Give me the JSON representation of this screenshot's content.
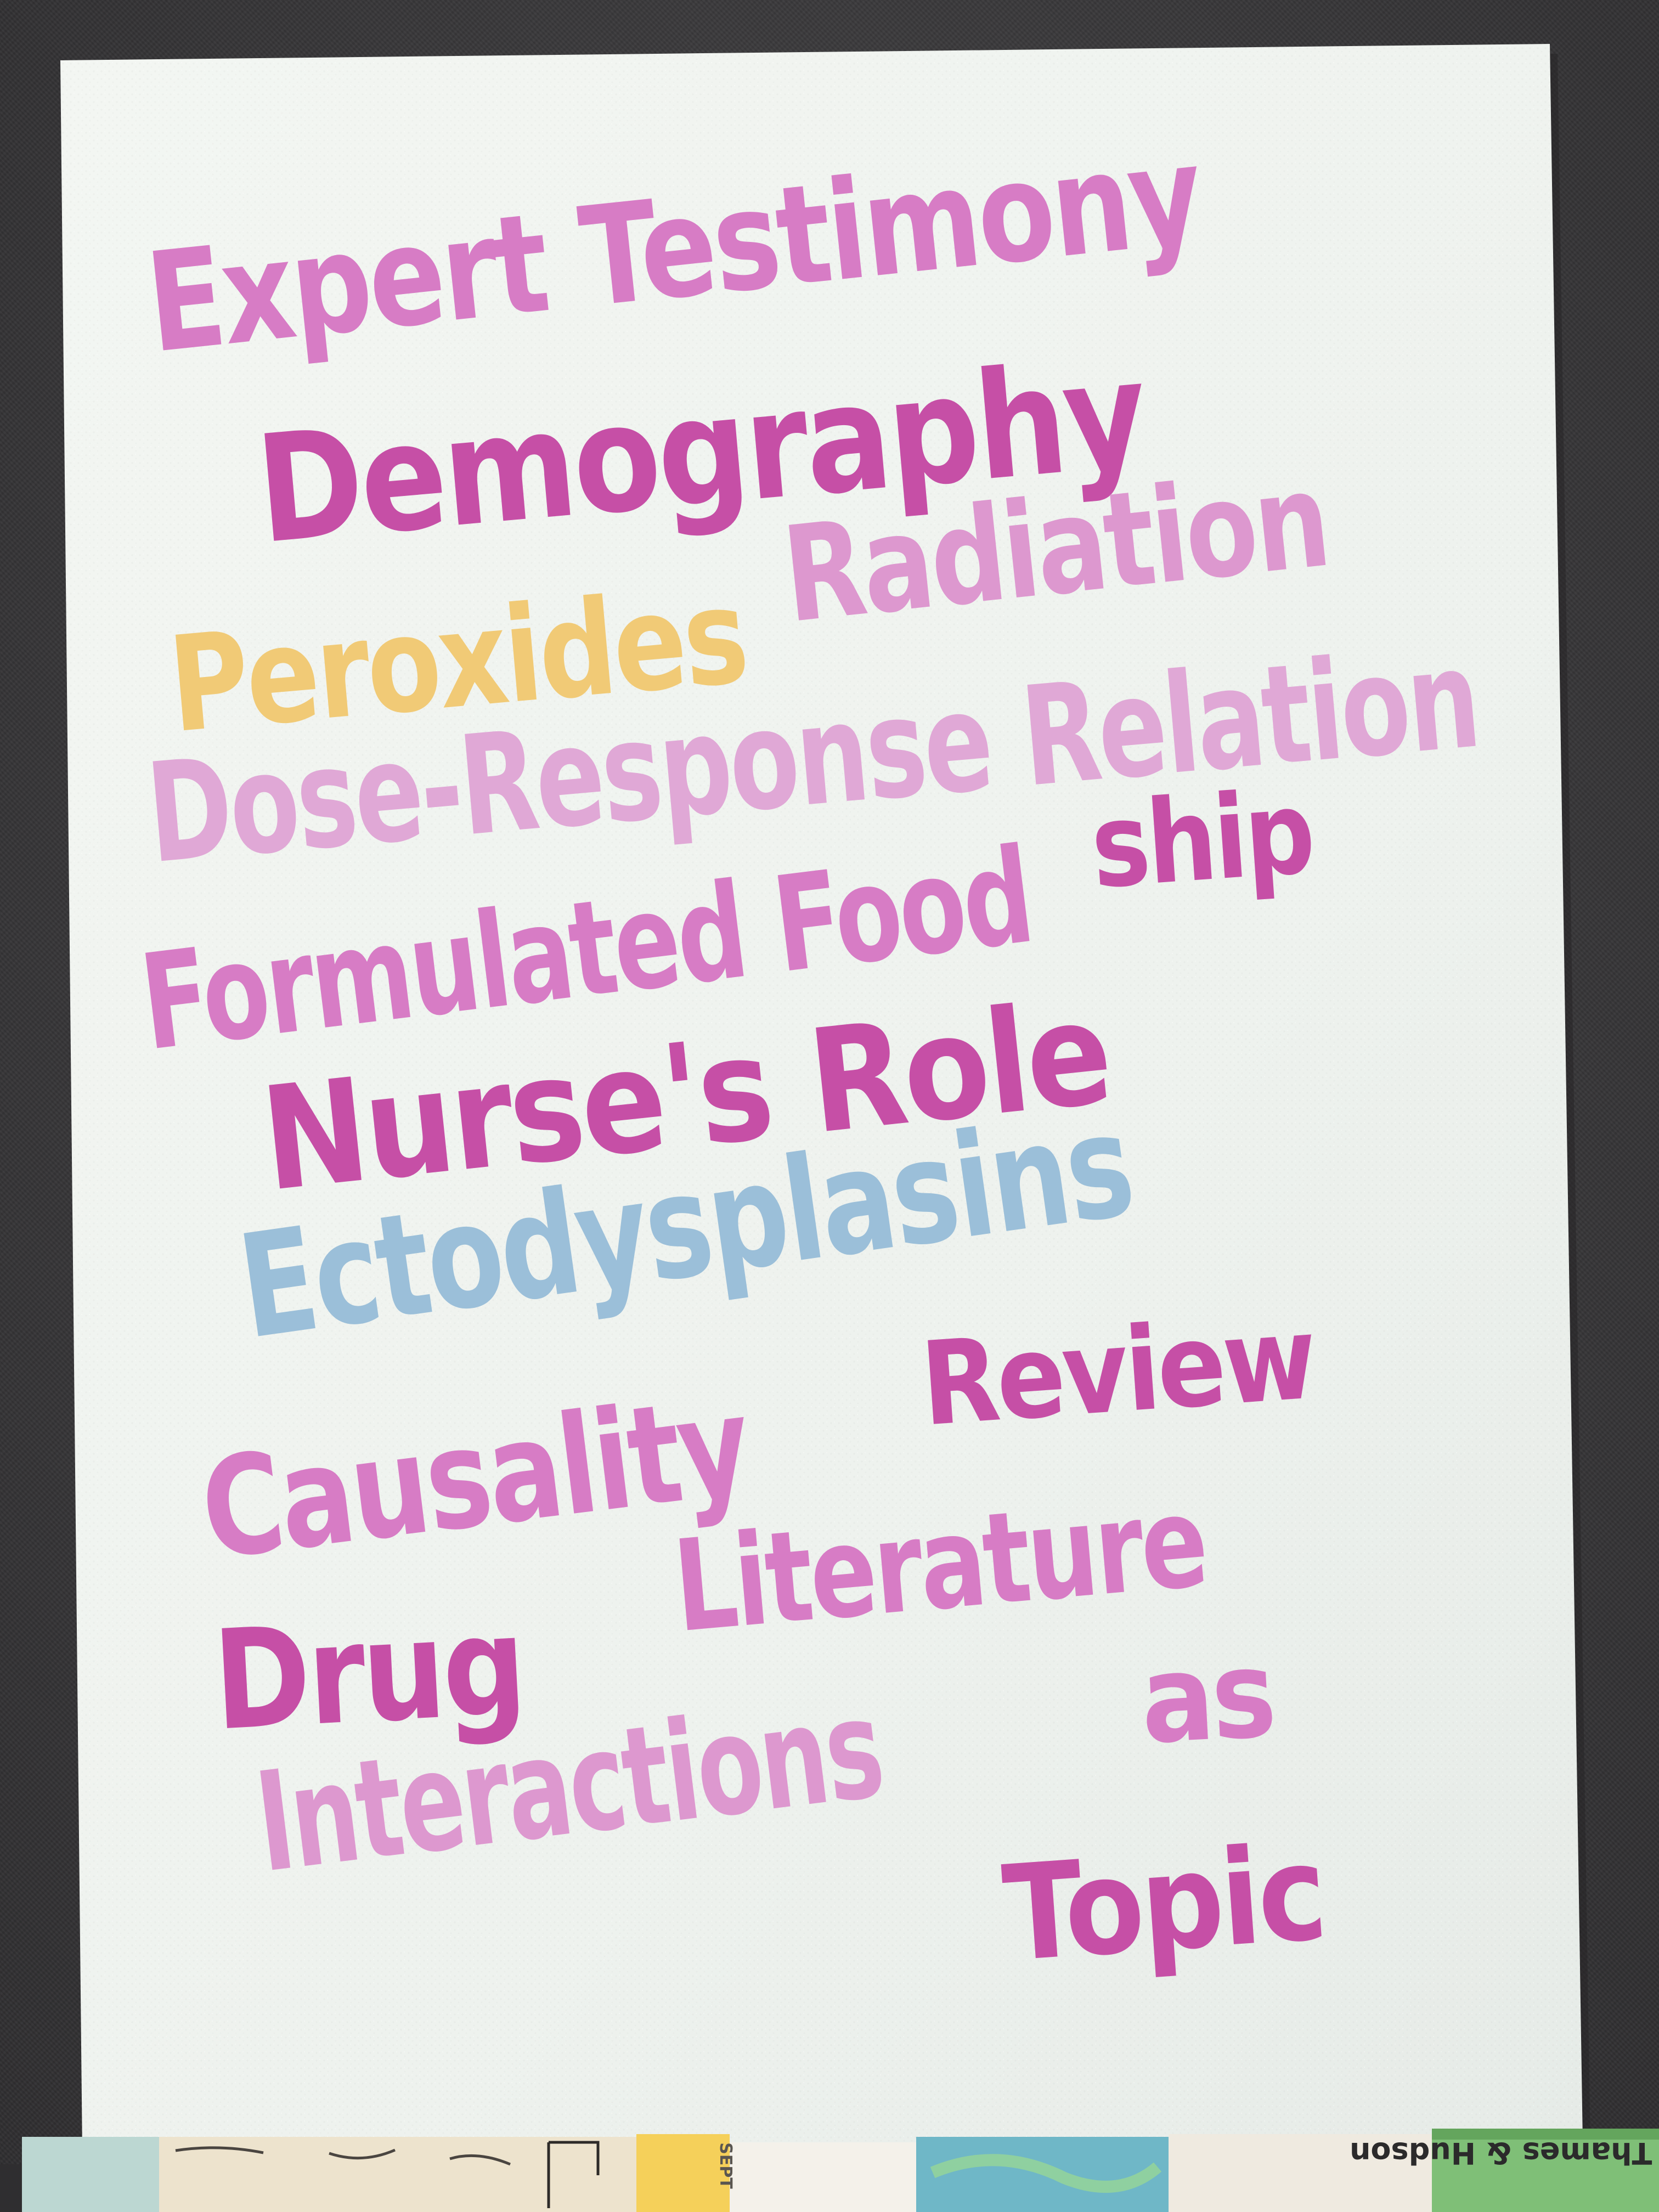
{
  "colors": {
    "background": "#3c3b3d",
    "paper": "#f1f4f0",
    "pink_mid": "#d77cc5",
    "pink_deep": "#c64fa6",
    "pink_light": "#dd98cf",
    "yellow": "#f1ca76",
    "blue": "#9bbfd9"
  },
  "lettering": {
    "expert_testimony": "Expert Testimony",
    "demography": "Demography",
    "peroxides": "Peroxides",
    "radiation": "Radiation",
    "dose_response": "Dose-Response Relation",
    "ship": "ship",
    "formulated_food": "Formulated Food",
    "nurses_role": "Nurse's Role",
    "ectodysplasins": "Ectodysplasins",
    "causality": "Causality",
    "review": "Review",
    "drug": "Drug",
    "literature": "Literature",
    "as": "as",
    "interactions": "Interactions",
    "topic": "Topic"
  },
  "background_items": {
    "map_label": "Thames & Hudson",
    "sept_label": "SEPT"
  }
}
